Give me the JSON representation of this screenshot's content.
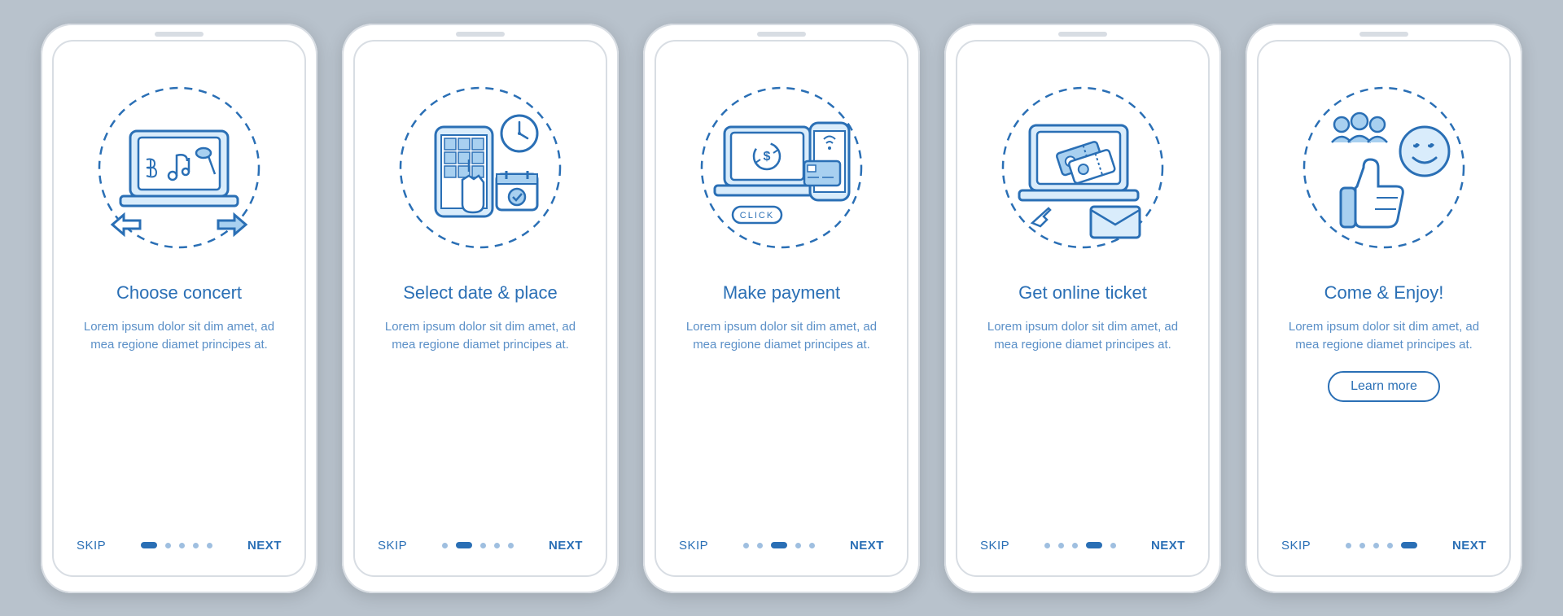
{
  "colors": {
    "primary": "#2a6fb5",
    "light": "#a8d0f0",
    "fill": "#d9ecfb"
  },
  "common": {
    "skip_label": "SKIP",
    "next_label": "NEXT",
    "body_text": "Lorem ipsum dolor sit dim amet, ad mea regione diamet principes at.",
    "total_steps": 5
  },
  "screens": [
    {
      "id": "choose-concert",
      "title": "Choose concert",
      "icon": "laptop-music",
      "active_dot": 0,
      "has_learn_more": false
    },
    {
      "id": "select-date",
      "title": "Select date & place",
      "icon": "date-place",
      "active_dot": 1,
      "has_learn_more": false
    },
    {
      "id": "make-payment",
      "title": "Make payment",
      "icon": "payment",
      "active_dot": 2,
      "has_learn_more": false
    },
    {
      "id": "get-ticket",
      "title": "Get online ticket",
      "icon": "ticket",
      "active_dot": 3,
      "has_learn_more": false
    },
    {
      "id": "come-enjoy",
      "title": "Come & Enjoy!",
      "icon": "enjoy",
      "active_dot": 4,
      "has_learn_more": true,
      "learn_more_label": "Learn more"
    }
  ]
}
